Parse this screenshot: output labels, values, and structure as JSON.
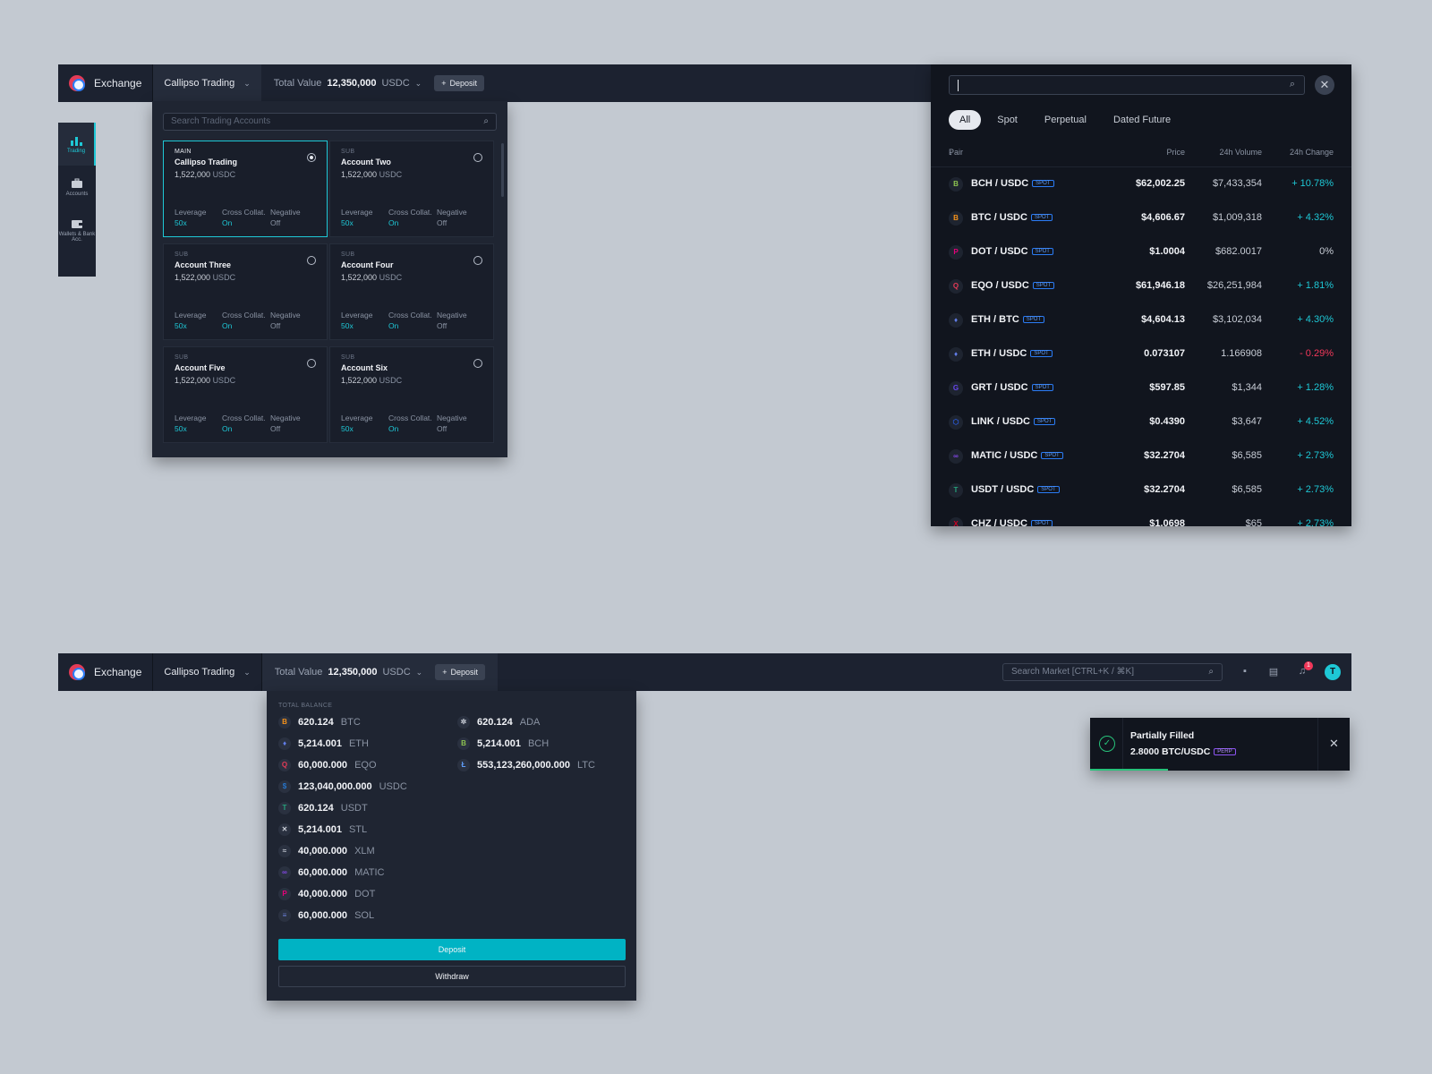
{
  "top_header": {
    "brand": "Exchange",
    "account": "Callipso Trading",
    "total_value_label": "Total Value",
    "total_value": "12,350,000",
    "currency": "USDC",
    "deposit": "Deposit"
  },
  "sidebar": {
    "items": [
      {
        "label": "Trading",
        "icon": "bar-chart-icon"
      },
      {
        "label": "Accounts",
        "icon": "briefcase-icon"
      },
      {
        "label": "Wallets & Bank Acc.",
        "icon": "wallet-icon"
      }
    ]
  },
  "account_panel": {
    "search_placeholder": "Search Trading Accounts",
    "cards": [
      {
        "type": "MAIN",
        "name": "Callipso Trading",
        "balance": "1,522,000",
        "currency": "USDC",
        "leverage_label": "Leverage",
        "leverage": "50x",
        "cross_label": "Cross Collat.",
        "cross": "On",
        "negative_label": "Negative",
        "negative": "Off",
        "selected": true
      },
      {
        "type": "SUB",
        "name": "Account Two",
        "balance": "1,522,000",
        "currency": "USDC",
        "leverage_label": "Leverage",
        "leverage": "50x",
        "cross_label": "Cross Collat.",
        "cross": "On",
        "negative_label": "Negative",
        "negative": "Off",
        "selected": false
      },
      {
        "type": "SUB",
        "name": "Account Three",
        "balance": "1,522,000",
        "currency": "USDC",
        "leverage_label": "Leverage",
        "leverage": "50x",
        "cross_label": "Cross Collat.",
        "cross": "On",
        "negative_label": "Negative",
        "negative": "Off",
        "selected": false
      },
      {
        "type": "SUB",
        "name": "Account Four",
        "balance": "1,522,000",
        "currency": "USDC",
        "leverage_label": "Leverage",
        "leverage": "50x",
        "cross_label": "Cross Collat.",
        "cross": "On",
        "negative_label": "Negative",
        "negative": "Off",
        "selected": false
      },
      {
        "type": "SUB",
        "name": "Account Five",
        "balance": "1,522,000",
        "currency": "USDC",
        "leverage_label": "Leverage",
        "leverage": "50x",
        "cross_label": "Cross Collat.",
        "cross": "On",
        "negative_label": "Negative",
        "negative": "Off",
        "selected": false
      },
      {
        "type": "SUB",
        "name": "Account Six",
        "balance": "1,522,000",
        "currency": "USDC",
        "leverage_label": "Leverage",
        "leverage": "50x",
        "cross_label": "Cross Collat.",
        "cross": "On",
        "negative_label": "Negative",
        "negative": "Off",
        "selected": false
      }
    ]
  },
  "market_panel": {
    "search_value": "",
    "tabs": [
      "All",
      "Spot",
      "Perpetual",
      "Dated Future"
    ],
    "active_tab": "All",
    "columns": {
      "pair": "Pair",
      "price": "Price",
      "volume": "24h Volume",
      "change": "24h Change"
    },
    "rows": [
      {
        "pair": "BCH / USDC",
        "badge": "SPOT",
        "price": "$62,002.25",
        "volume": "$7,433,354",
        "change": "+ 10.78%",
        "dir": "up",
        "coin": "B",
        "color": "#8dc351"
      },
      {
        "pair": "BTC / USDC",
        "badge": "SPOT",
        "price": "$4,606.67",
        "volume": "$1,009,318",
        "change": "+ 4.32%",
        "dir": "up",
        "coin": "B",
        "color": "#f7931a"
      },
      {
        "pair": "DOT / USDC",
        "badge": "SPOT",
        "price": "$1.0004",
        "volume": "$682.0017",
        "change": "0%",
        "dir": "flat",
        "coin": "P",
        "color": "#e6007a"
      },
      {
        "pair": "EQO / USDC",
        "badge": "SPOT",
        "price": "$61,946.18",
        "volume": "$26,251,984",
        "change": "+ 1.81%",
        "dir": "up",
        "coin": "Q",
        "color": "#e33b57"
      },
      {
        "pair": "ETH / BTC",
        "badge": "SPOT",
        "price": "$4,604.13",
        "volume": "$3,102,034",
        "change": "+ 4.30%",
        "dir": "up",
        "coin": "♦",
        "color": "#627eea"
      },
      {
        "pair": "ETH / USDC",
        "badge": "SPOT",
        "price": "0.073107",
        "volume": "1.166908",
        "change": "- 0.29%",
        "dir": "down",
        "coin": "♦",
        "color": "#627eea"
      },
      {
        "pair": "GRT / USDC",
        "badge": "SPOT",
        "price": "$597.85",
        "volume": "$1,344",
        "change": "+ 1.28%",
        "dir": "up",
        "coin": "G",
        "color": "#6747ed"
      },
      {
        "pair": "LINK / USDC",
        "badge": "SPOT",
        "price": "$0.4390",
        "volume": "$3,647",
        "change": "+ 4.52%",
        "dir": "up",
        "coin": "⬡",
        "color": "#2a5ada"
      },
      {
        "pair": "MATIC / USDC",
        "badge": "SPOT",
        "price": "$32.2704",
        "volume": "$6,585",
        "change": "+ 2.73%",
        "dir": "up",
        "coin": "∞",
        "color": "#8247e5"
      },
      {
        "pair": "USDT / USDC",
        "badge": "SPOT",
        "price": "$32.2704",
        "volume": "$6,585",
        "change": "+ 2.73%",
        "dir": "up",
        "coin": "T",
        "color": "#26a17b"
      },
      {
        "pair": "CHZ / USDC",
        "badge": "SPOT",
        "price": "$1.0698",
        "volume": "$65",
        "change": "+ 2.73%",
        "dir": "up",
        "coin": "X",
        "color": "#cd0124"
      }
    ]
  },
  "bottom_header": {
    "brand": "Exchange",
    "account": "Callipso Trading",
    "total_value_label": "Total Value",
    "total_value": "12,350,000",
    "currency": "USDC",
    "deposit": "Deposit",
    "search_placeholder": "Search Market  [CTRL+K / ⌘K]",
    "notification_count": "1",
    "avatar_initial": "T"
  },
  "balance_panel": {
    "title": "TOTAL BALANCE",
    "left": [
      {
        "amount": "620.124",
        "symbol": "BTC",
        "coin": "B",
        "color": "#f7931a"
      },
      {
        "amount": "5,214.001",
        "symbol": "ETH",
        "coin": "♦",
        "color": "#627eea"
      },
      {
        "amount": "60,000.000",
        "symbol": "EQO",
        "coin": "Q",
        "color": "#e33b57"
      },
      {
        "amount": "123,040,000.000",
        "symbol": "USDC",
        "coin": "$",
        "color": "#2775ca"
      },
      {
        "amount": "620.124",
        "symbol": "USDT",
        "coin": "T",
        "color": "#26a17b"
      },
      {
        "amount": "5,214.001",
        "symbol": "STL",
        "coin": "✕",
        "color": "#c8cdd6"
      },
      {
        "amount": "40,000.000",
        "symbol": "XLM",
        "coin": "≈",
        "color": "#c8cdd6"
      },
      {
        "amount": "60,000.000",
        "symbol": "MATIC",
        "coin": "∞",
        "color": "#8247e5"
      },
      {
        "amount": "40,000.000",
        "symbol": "DOT",
        "coin": "P",
        "color": "#e6007a"
      },
      {
        "amount": "60,000.000",
        "symbol": "SOL",
        "coin": "≡",
        "color": "#6a7fd8"
      }
    ],
    "right": [
      {
        "amount": "620.124",
        "symbol": "ADA",
        "coin": "✲",
        "color": "#c8cdd6"
      },
      {
        "amount": "5,214.001",
        "symbol": "BCH",
        "coin": "B",
        "color": "#8dc351"
      },
      {
        "amount": "553,123,260,000.000",
        "symbol": "LTC",
        "coin": "Ł",
        "color": "#5e9cf7"
      }
    ],
    "deposit": "Deposit",
    "withdraw": "Withdraw"
  },
  "toast": {
    "title": "Partially Filled",
    "amount": "2.8000",
    "pair": "BTC/USDC",
    "badge": "PERP",
    "progress": 0.3
  }
}
